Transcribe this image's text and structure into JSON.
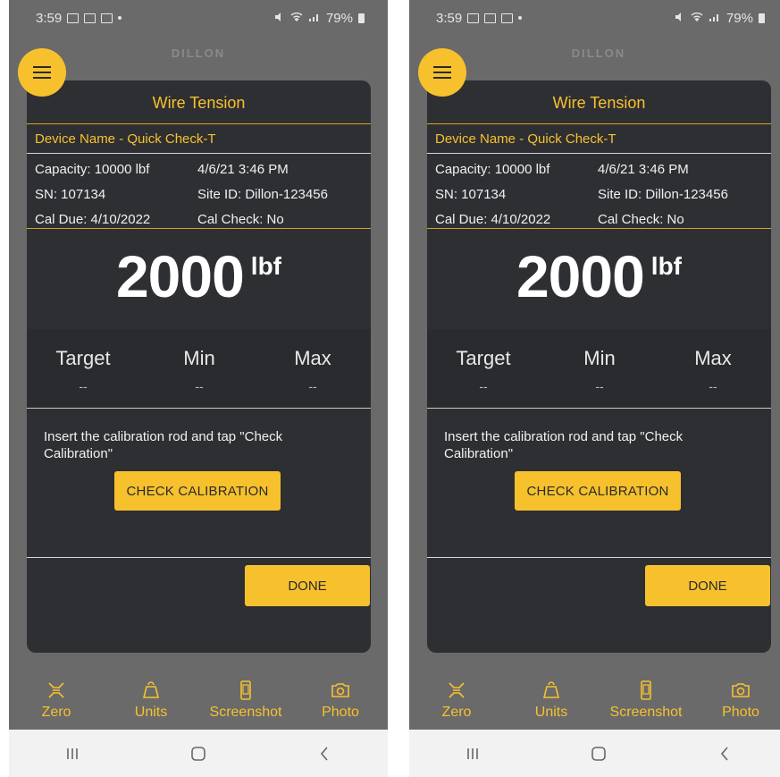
{
  "colors": {
    "accent": "#f7c12d",
    "card": "#2e2f33",
    "frame": "#6a6a6a"
  },
  "screens": [
    {
      "status": {
        "time": "3:59",
        "battery": "79%"
      },
      "brand": "DILLON",
      "card": {
        "title": "Wire Tension",
        "device": "Device Name  -  Quick Check-T",
        "info": {
          "capacity": "Capacity: 10000 lbf",
          "datetime": "4/6/21 3:46 PM",
          "sn": "SN: 107134",
          "site_id": "Site ID: Dillon-123456",
          "cal_due": "Cal Due:  4/10/2022",
          "cal_check": "Cal Check: No"
        },
        "reading": {
          "value": "2000",
          "unit": "lbf"
        },
        "limits": {
          "target_label": "Target",
          "target_value": "--",
          "min_label": "Min",
          "min_value": "--",
          "max_label": "Max",
          "max_value": "--"
        },
        "instruction": "Insert the calibration rod and tap \"Check Calibration\"",
        "check_button": "CHECK CALIBRATION",
        "done_button": "DONE"
      },
      "tabs": {
        "zero": "Zero",
        "units": "Units",
        "screenshot": "Screenshot",
        "photo": "Photo"
      }
    },
    {
      "status": {
        "time": "3:59",
        "battery": "79%"
      },
      "brand": "DILLON",
      "card": {
        "title": "Wire Tension",
        "device": "Device Name  -  Quick Check-T",
        "info": {
          "capacity": "Capacity: 10000 lbf",
          "datetime": "4/6/21 3:46 PM",
          "sn": "SN: 107134",
          "site_id": "Site ID: Dillon-123456",
          "cal_due": "Cal Due:  4/10/2022",
          "cal_check": "Cal Check: No"
        },
        "reading": {
          "value": "2000",
          "unit": "lbf"
        },
        "limits": {
          "target_label": "Target",
          "target_value": "--",
          "min_label": "Min",
          "min_value": "--",
          "max_label": "Max",
          "max_value": "--"
        },
        "instruction": "Insert the calibration rod and tap \"Check Calibration\"",
        "check_button": "CHECK CALIBRATION",
        "done_button": "DONE"
      },
      "tabs": {
        "zero": "Zero",
        "units": "Units",
        "screenshot": "Screenshot",
        "photo": "Photo"
      }
    }
  ]
}
